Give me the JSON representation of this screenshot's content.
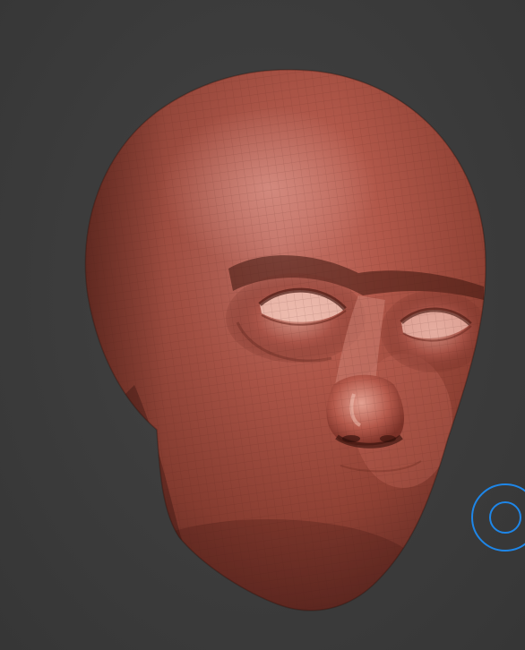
{
  "viewport": {
    "background": "#3c3c3c",
    "model": "sculpted-head",
    "model_color": "#b5584a",
    "shading": "polygroup-wireframe"
  },
  "brush_cursor": {
    "icon": "brush-ring-icon",
    "color": "#1e86e8"
  }
}
